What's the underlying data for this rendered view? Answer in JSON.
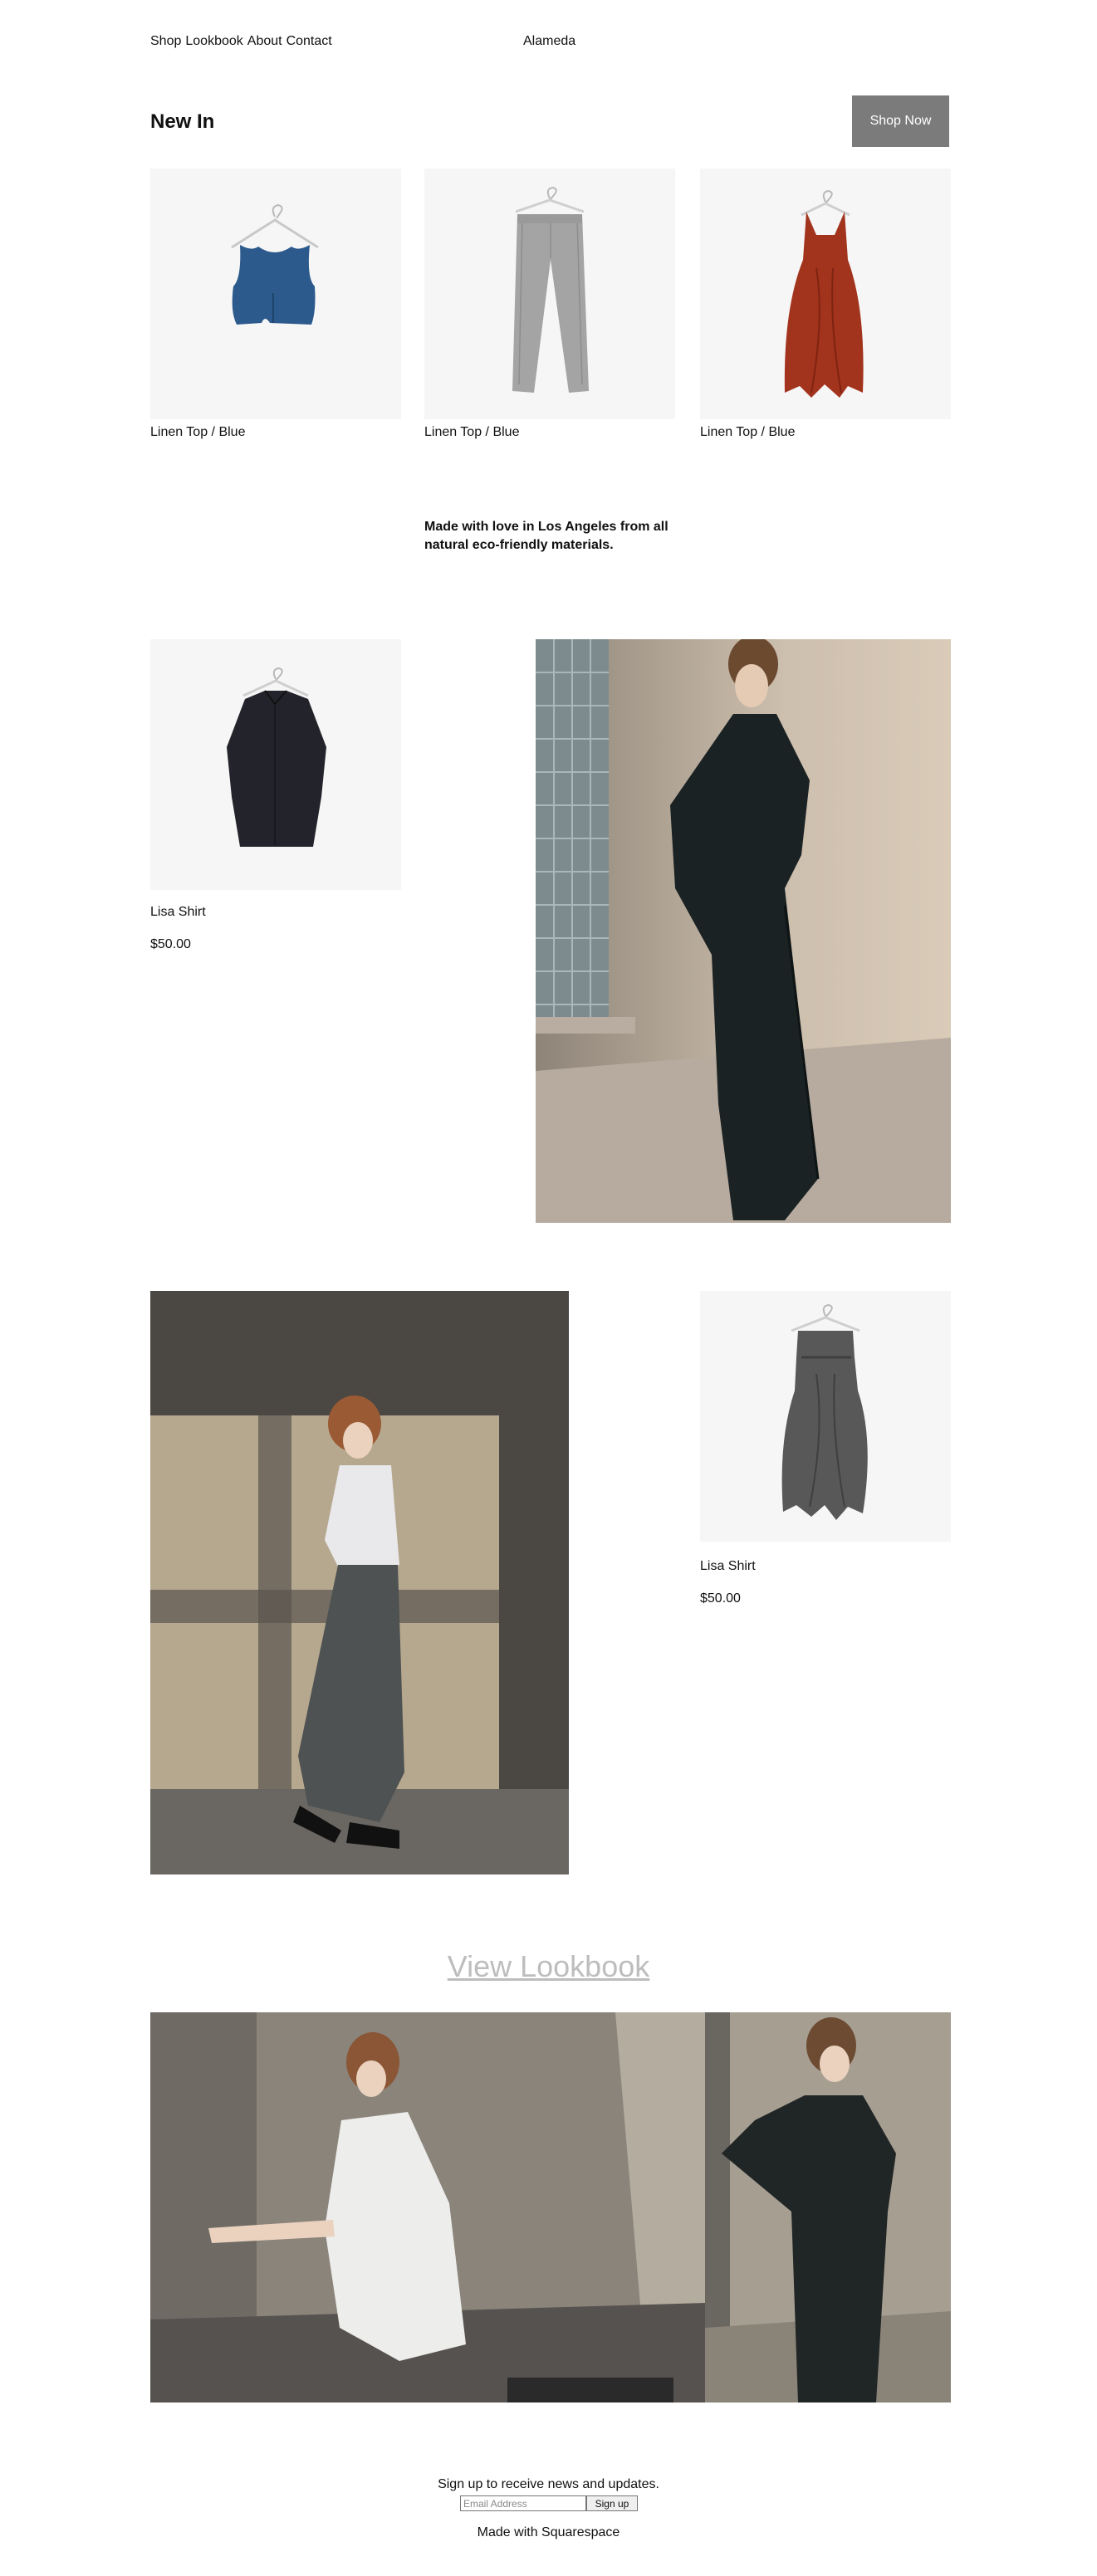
{
  "header": {
    "nav": [
      "Shop",
      "Lookbook",
      "About",
      "Contact"
    ],
    "brand": "Alameda"
  },
  "new_in": {
    "title": "New In",
    "shop_now": "Shop Now",
    "products": [
      {
        "caption": "Linen Top / Blue",
        "image": "blue-sleeveless-top"
      },
      {
        "caption": "Linen Top / Blue",
        "image": "gray-plaid-trousers"
      },
      {
        "caption": "Linen Top / Blue",
        "image": "rust-wrap-dress"
      }
    ]
  },
  "tagline": "Made with love in Los Angeles from all natural eco-friendly materials.",
  "feature_1": {
    "name": "Lisa Shirt",
    "price": "$50.00",
    "image": "navy-shirt-on-hanger",
    "photo": "model-in-dark-jumpsuit"
  },
  "feature_2": {
    "name": "Lisa Shirt",
    "price": "$50.00",
    "image": "gray-draped-skirt-on-hanger",
    "photo": "model-in-white-top-and-gray-skirt"
  },
  "lookbook": {
    "link": "View Lookbook",
    "photos": [
      "model-crouching-in-white-dress",
      "model-in-black-wrap-dress"
    ]
  },
  "footer": {
    "newsletter": "Sign up to receive news and updates.",
    "email_placeholder": "Email Address",
    "signup_label": "Sign up",
    "credit": "Made with Squarespace"
  },
  "colors": {
    "button_bg": "#7b7b7b",
    "tile_bg": "#f6f6f6",
    "link_muted": "#bdbdbd"
  }
}
